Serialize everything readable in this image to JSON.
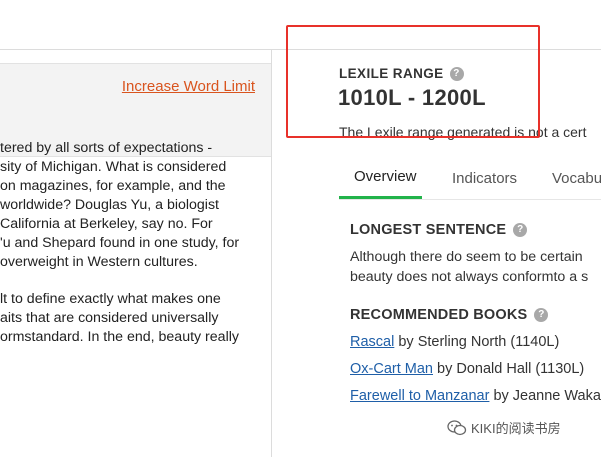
{
  "left": {
    "increase_label": "Increase Word Limit",
    "passage_lines": [
      "tered by all sorts of expectations -",
      "sity of Michigan. What is considered",
      "on magazines, for example, and the",
      "worldwide? Douglas Yu, a biologist",
      "California at Berkeley, say no. For",
      "'u and Shepard found in one study, for",
      "overweight in Western cultures.",
      "",
      "lt to define exactly what makes one",
      "aits that are considered universally",
      "ormstandard. In the end, beauty really"
    ]
  },
  "right": {
    "lexile_label": "LEXILE RANGE",
    "lexile_value": "1010L - 1200L",
    "lexile_desc": "The Lexile range generated is not a cert",
    "tabs": [
      "Overview",
      "Indicators",
      "Vocabu"
    ],
    "longest_sentence": {
      "title": "LONGEST SENTENCE",
      "line1": "Although there do seem to be certain",
      "line2": "beauty does not always conformto a s"
    },
    "recommended": {
      "title": "RECOMMENDED BOOKS",
      "books": [
        {
          "title": "Rascal",
          "rest": " by Sterling North (1140L)"
        },
        {
          "title": "Ox-Cart Man",
          "rest": " by Donald Hall (1130L)"
        },
        {
          "title": "Farewell to Manzanar",
          "rest": " by Jeanne Waka"
        }
      ]
    }
  },
  "watermark": "KIKI的阅读书房",
  "colors": {
    "accent_green": "#22b34a",
    "link_blue": "#1f5fa8",
    "link_orange": "#d9541e",
    "highlight_red": "#e8312a"
  },
  "icons": [
    "help-icon",
    "wechat-icon"
  ]
}
